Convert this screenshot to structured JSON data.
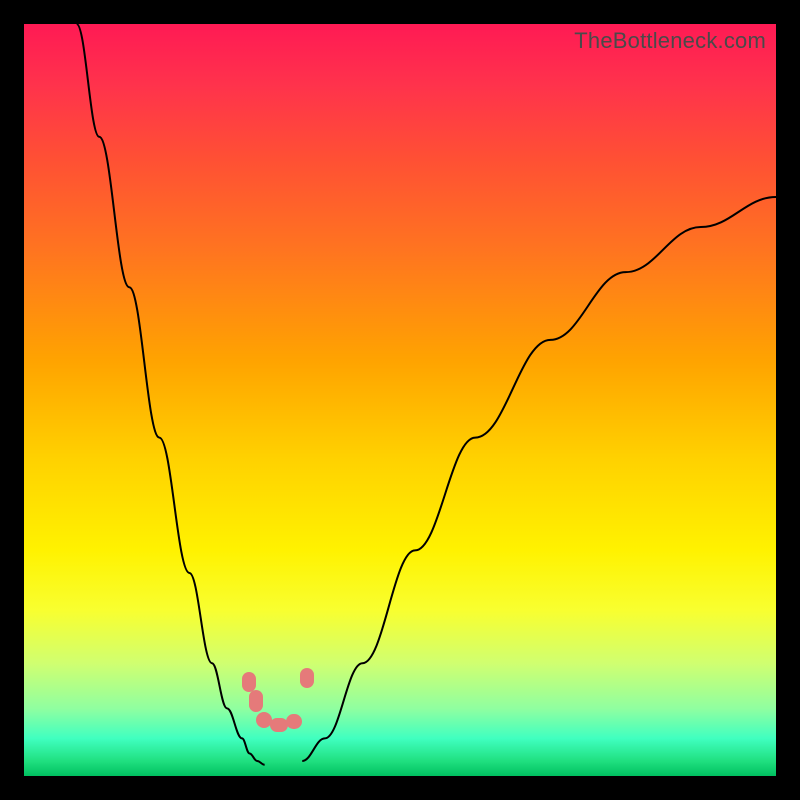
{
  "watermark": "TheBottleneck.com",
  "chart_data": {
    "type": "line",
    "title": "",
    "xlabel": "",
    "ylabel": "",
    "xlim": [
      0,
      100
    ],
    "ylim": [
      0,
      100
    ],
    "series": [
      {
        "name": "left-curve",
        "x": [
          7,
          10,
          14,
          18,
          22,
          25,
          27,
          29,
          30,
          31,
          32
        ],
        "y": [
          100,
          85,
          65,
          45,
          27,
          15,
          9,
          5,
          3,
          2,
          1.5
        ]
      },
      {
        "name": "right-curve",
        "x": [
          37,
          40,
          45,
          52,
          60,
          70,
          80,
          90,
          100
        ],
        "y": [
          2,
          5,
          15,
          30,
          45,
          58,
          67,
          73,
          77
        ]
      }
    ],
    "markers": [
      {
        "name": "blob-left-upper",
        "x": 29.5,
        "y": 13
      },
      {
        "name": "blob-left-lower",
        "x": 30.5,
        "y": 9
      },
      {
        "name": "blob-bottom-1",
        "x": 31.5,
        "y": 6.5
      },
      {
        "name": "blob-bottom-2",
        "x": 33.5,
        "y": 6
      },
      {
        "name": "blob-bottom-3",
        "x": 35.5,
        "y": 6.5
      },
      {
        "name": "blob-right",
        "x": 37.5,
        "y": 14
      }
    ],
    "gradient_stops": [
      {
        "pct": 0,
        "color": "#ff1a54"
      },
      {
        "pct": 45,
        "color": "#ffa400"
      },
      {
        "pct": 70,
        "color": "#fff200"
      },
      {
        "pct": 100,
        "color": "#00c060"
      }
    ]
  }
}
